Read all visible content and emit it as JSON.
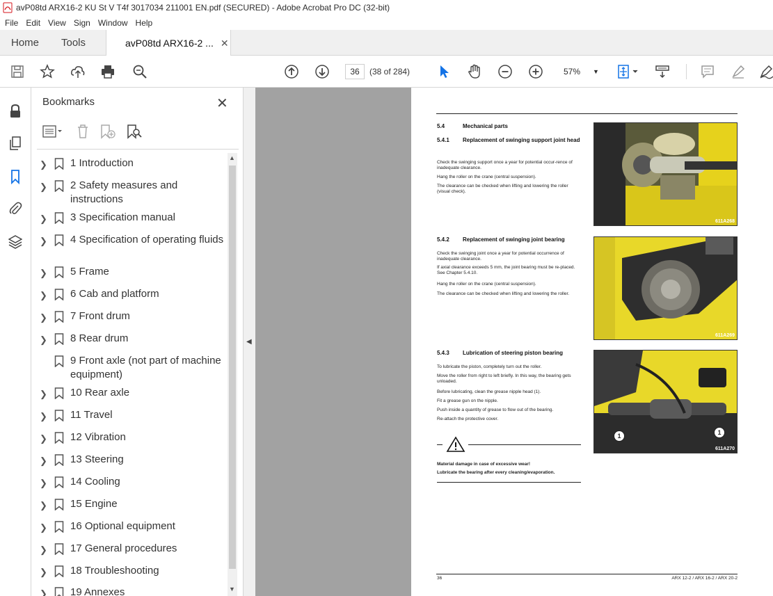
{
  "window": {
    "title": "avP08td ARX16-2 KU St V T4f 3017034 211001 EN.pdf (SECURED) - Adobe Acrobat Pro DC (32-bit)"
  },
  "menu": [
    "File",
    "Edit",
    "View",
    "Sign",
    "Window",
    "Help"
  ],
  "tabs": {
    "home": "Home",
    "tools": "Tools",
    "doc": "avP08td ARX16-2 ...",
    "close": "✕"
  },
  "toolbar": {
    "page_current": "36",
    "page_of": "(38 of 284)",
    "zoom": "57%",
    "icons": [
      "save-icon",
      "bookmark-star-icon",
      "upload-icon",
      "print-icon",
      "search-zoom-icon",
      "page-up-icon",
      "page-down-icon",
      "select-cursor-icon",
      "hand-icon",
      "zoom-out-icon",
      "zoom-in-icon",
      "fit-page-icon",
      "scroll-mode-icon",
      "comment-icon",
      "highlight-icon",
      "sign-icon"
    ]
  },
  "left_rail": {
    "icons": [
      "lock-icon",
      "pages-icon",
      "bookmark-icon",
      "attachment-icon",
      "layers-icon"
    ]
  },
  "bookmarks_panel": {
    "title": "Bookmarks",
    "close": "✕",
    "items": [
      {
        "label": "1 Introduction",
        "expandable": true
      },
      {
        "label": "2 Safety measures and instructions",
        "expandable": true
      },
      {
        "label": "3 Specification manual",
        "expandable": true
      },
      {
        "label": "4 Specification of operating fluids",
        "expandable": true
      },
      {
        "label": "5 Frame",
        "expandable": true
      },
      {
        "label": "6 Cab and platform",
        "expandable": true
      },
      {
        "label": "7 Front drum",
        "expandable": true
      },
      {
        "label": "8 Rear drum",
        "expandable": true
      },
      {
        "label": "9 Front axle (not part of machine equipment)",
        "expandable": false
      },
      {
        "label": "10 Rear axle",
        "expandable": true
      },
      {
        "label": "11 Travel",
        "expandable": true
      },
      {
        "label": "12 Vibration",
        "expandable": true
      },
      {
        "label": "13 Steering",
        "expandable": true
      },
      {
        "label": "14 Cooling",
        "expandable": true
      },
      {
        "label": "15 Engine",
        "expandable": true
      },
      {
        "label": "16 Optional equipment",
        "expandable": true
      },
      {
        "label": "17 General procedures",
        "expandable": true
      },
      {
        "label": "18 Troubleshooting",
        "expandable": true
      },
      {
        "label": "19 Annexes",
        "expandable": true
      }
    ]
  },
  "document": {
    "s54_num": "5.4",
    "s54_title": "Mechanical parts",
    "s541_num": "5.4.1",
    "s541_title": "Replacement of swinging support joint head",
    "s541_body": [
      "Check the swinging support once a year for potential occur-rence of inadequate clearance.",
      "Hang the roller on the crane (central suspension).",
      "The clearance can be checked when lifting and lowering the roller (visual check)."
    ],
    "s542_num": "5.4.2",
    "s542_title": "Replacement of swinging joint bearing",
    "s542_body": [
      "Check the swinging joint once a year for potential occurrence of inadequate clearance.",
      "If axial clearance exceeds 5 mm, the joint bearing must be re-placed. See Chapter 5.4.10.",
      "Hang the roller on the crane (central suspension).",
      "The clearance can be checked when lifting and lowering the roller."
    ],
    "s543_num": "5.4.3",
    "s543_title": "Lubrication of steering piston bearing",
    "s543_body": [
      "To lubricate the piston, completely turn out the roller.",
      "Move the roller from right to left briefly. In this way, the bearing gets unloaded.",
      "Before lubricating, clean the grease nipple head (1).",
      "Fit a grease gun on the nipple.",
      "Push inside a quantity of grease to flow out of the bearing.",
      "Re-attach the protective cover."
    ],
    "warning_line1": "Material damage in case of excessive wear!",
    "warning_line2": "Lubricate the bearing after every cleaning/evaporation.",
    "photo1_caption": "611A268",
    "photo2_caption": "611A269",
    "photo3_caption": "611A270",
    "callout": "1",
    "footer_page": "36",
    "footer_models": "ARX 12-2 / ARX 16-2 / ARX 20-2"
  }
}
